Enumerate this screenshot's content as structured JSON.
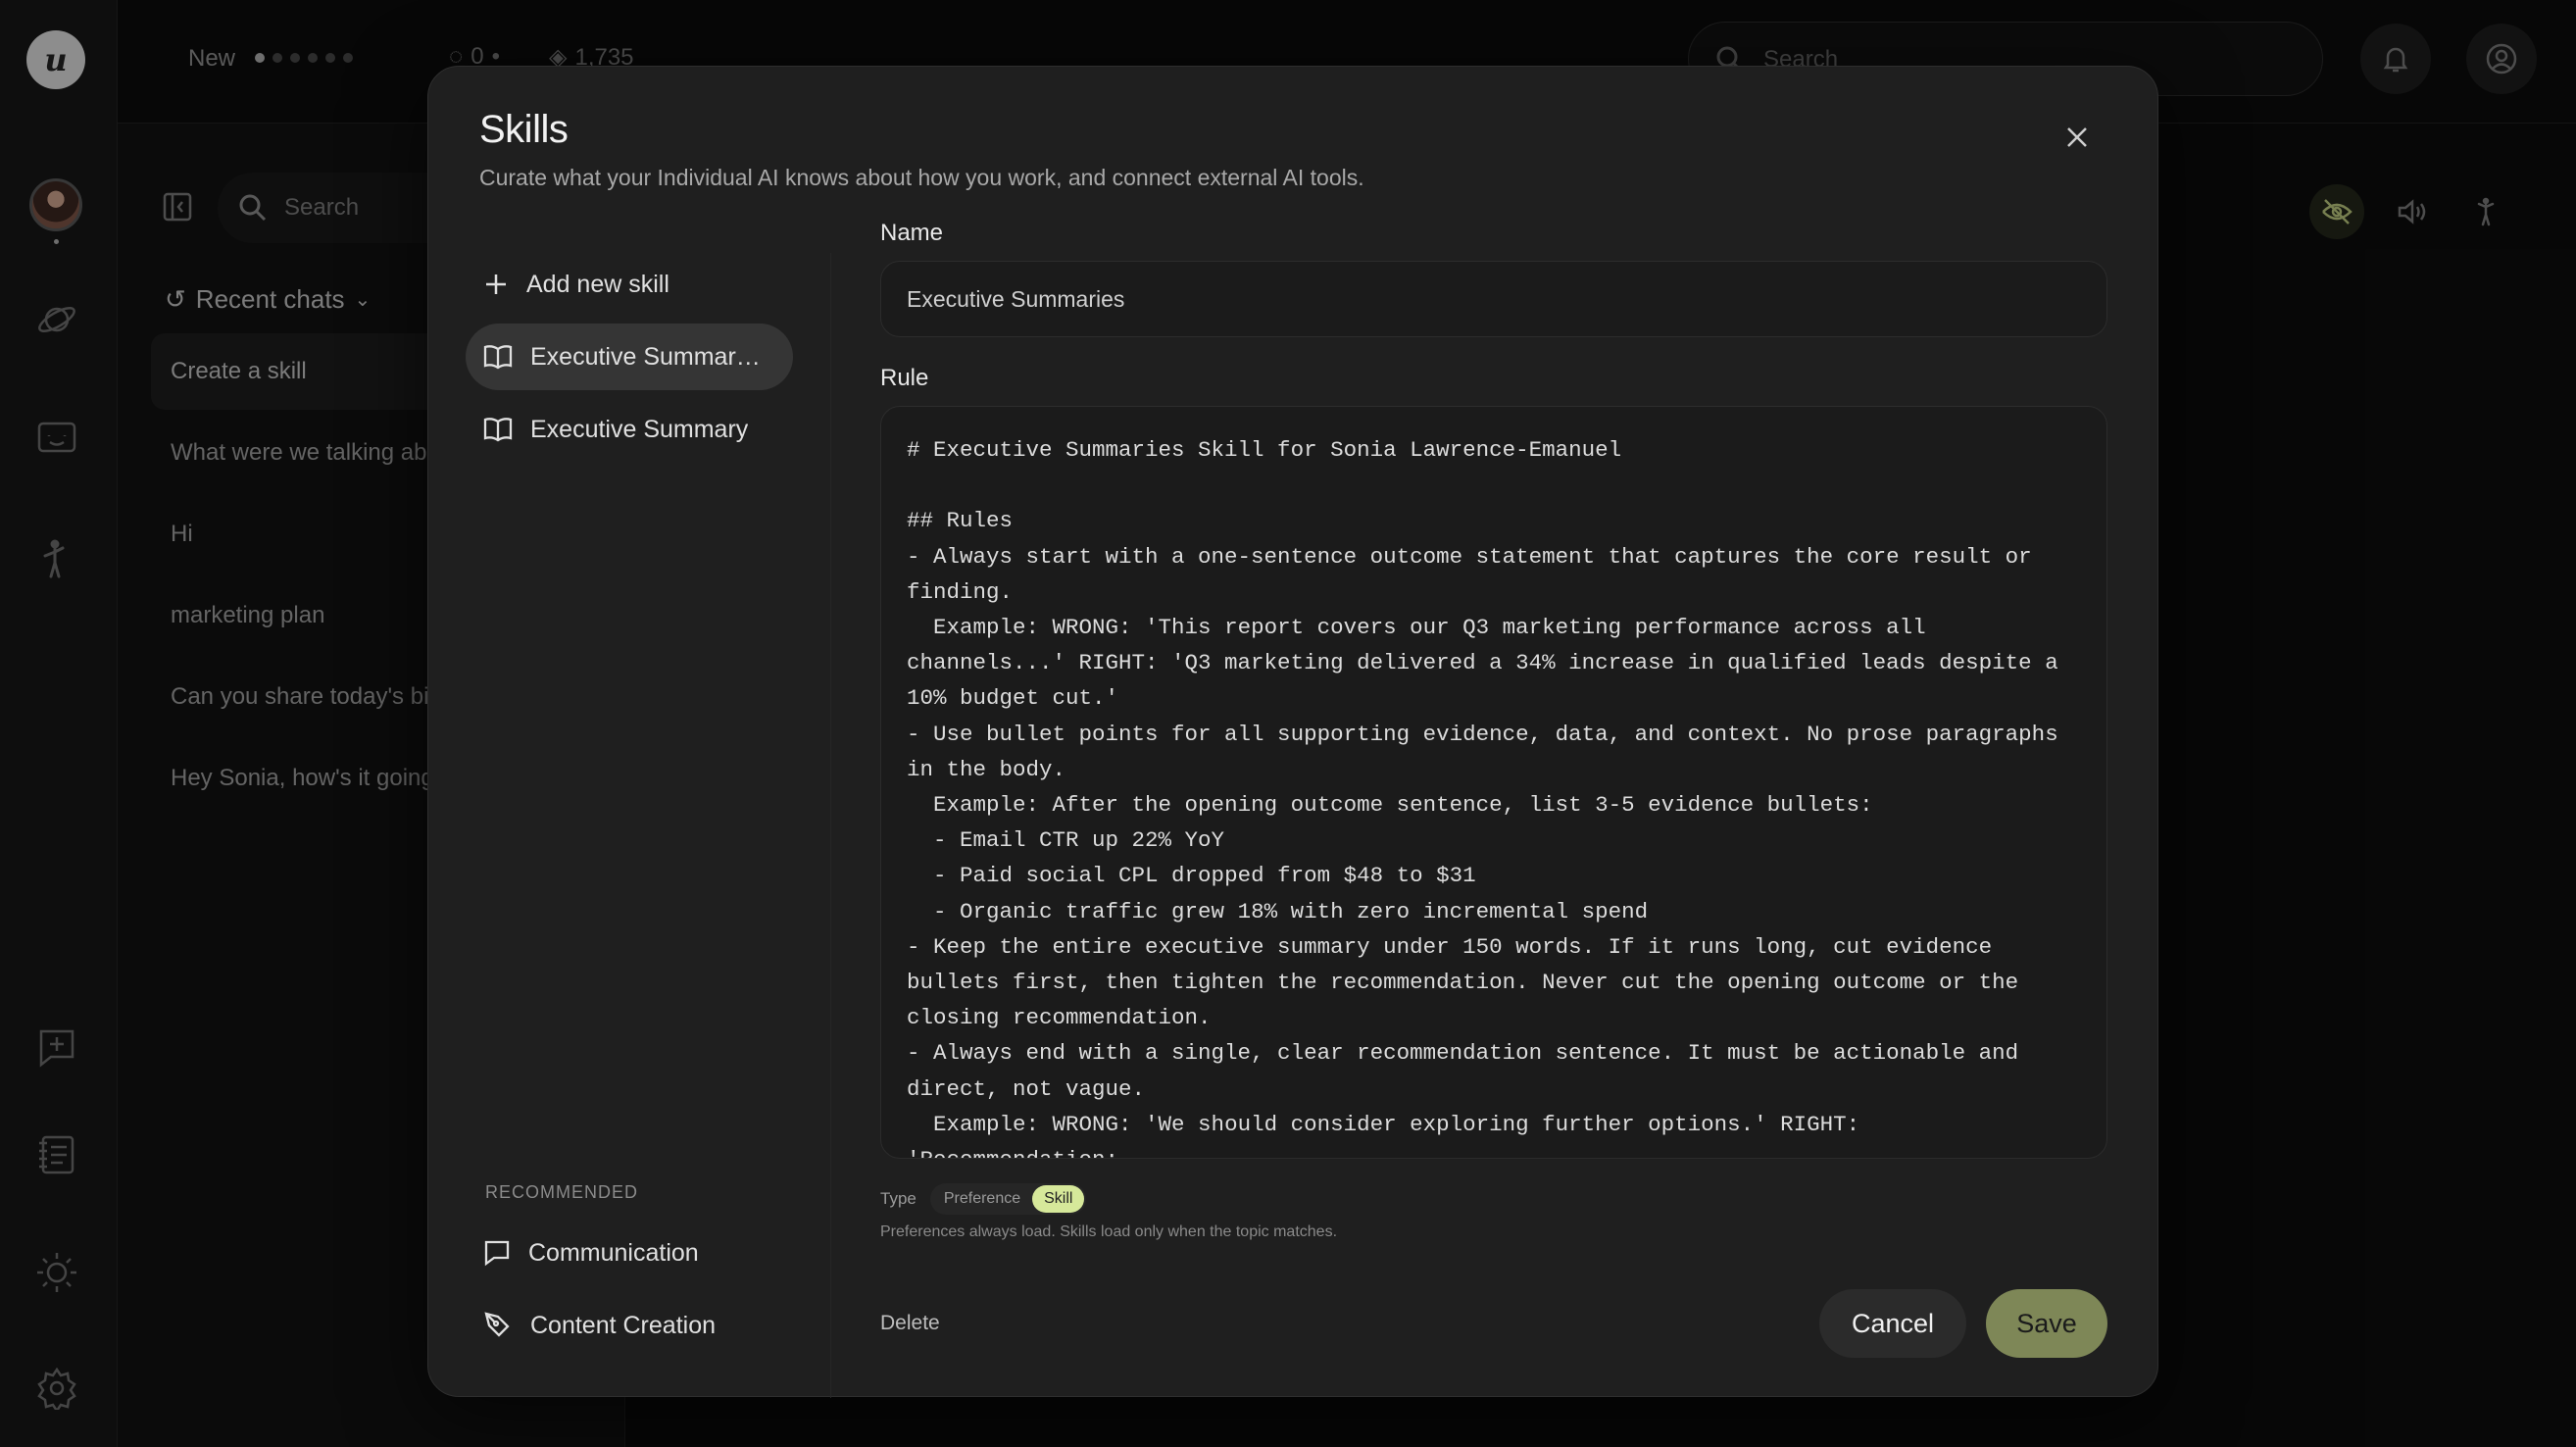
{
  "header": {
    "new_label": "New",
    "stat_one": "0",
    "stat_two": "1,735",
    "search_placeholder": "Search"
  },
  "chats": {
    "search_placeholder": "Search",
    "recent_label": "Recent chats",
    "items": [
      {
        "label": "Create a skill"
      },
      {
        "label": "What were we talking about"
      },
      {
        "label": "Hi"
      },
      {
        "label": "marketing plan"
      },
      {
        "label": "Can you share today's big"
      },
      {
        "label": "Hey Sonia, how's it going"
      }
    ]
  },
  "modal": {
    "title": "Skills",
    "subtitle": "Curate what your Individual AI knows about how you work, and connect external AI tools.",
    "add_skill": "Add new skill",
    "skills": [
      {
        "label": "Executive Summaries"
      },
      {
        "label": "Executive Summary"
      }
    ],
    "recommended_label": "RECOMMENDED",
    "recommended": [
      {
        "label": "Communication"
      },
      {
        "label": "Content Creation"
      }
    ],
    "name_label": "Name",
    "name_value": "Executive Summaries",
    "rule_label": "Rule",
    "rule_text": "# Executive Summaries Skill for Sonia Lawrence-Emanuel\n\n## Rules\n- Always start with a one-sentence outcome statement that captures the core result or finding.\n  Example: WRONG: 'This report covers our Q3 marketing performance across all channels...' RIGHT: 'Q3 marketing delivered a 34% increase in qualified leads despite a 10% budget cut.'\n- Use bullet points for all supporting evidence, data, and context. No prose paragraphs in the body.\n  Example: After the opening outcome sentence, list 3-5 evidence bullets:\n  - Email CTR up 22% YoY\n  - Paid social CPL dropped from $48 to $31\n  - Organic traffic grew 18% with zero incremental spend\n- Keep the entire executive summary under 150 words. If it runs long, cut evidence bullets first, then tighten the recommendation. Never cut the opening outcome or the closing recommendation.\n- Always end with a single, clear recommendation sentence. It must be actionable and direct, not vague.\n  Example: WRONG: 'We should consider exploring further options.' RIGHT: 'Recommendation:",
    "type_label": "Type",
    "type_options": [
      "Preference",
      "Skill"
    ],
    "type_selected": "Skill",
    "hint": "Preferences always load. Skills load only when the topic matches.",
    "delete_label": "Delete",
    "cancel_label": "Cancel",
    "save_label": "Save"
  },
  "colors": {
    "accent_save": "#7e8757",
    "accent_toggle": "#d6e89a"
  }
}
